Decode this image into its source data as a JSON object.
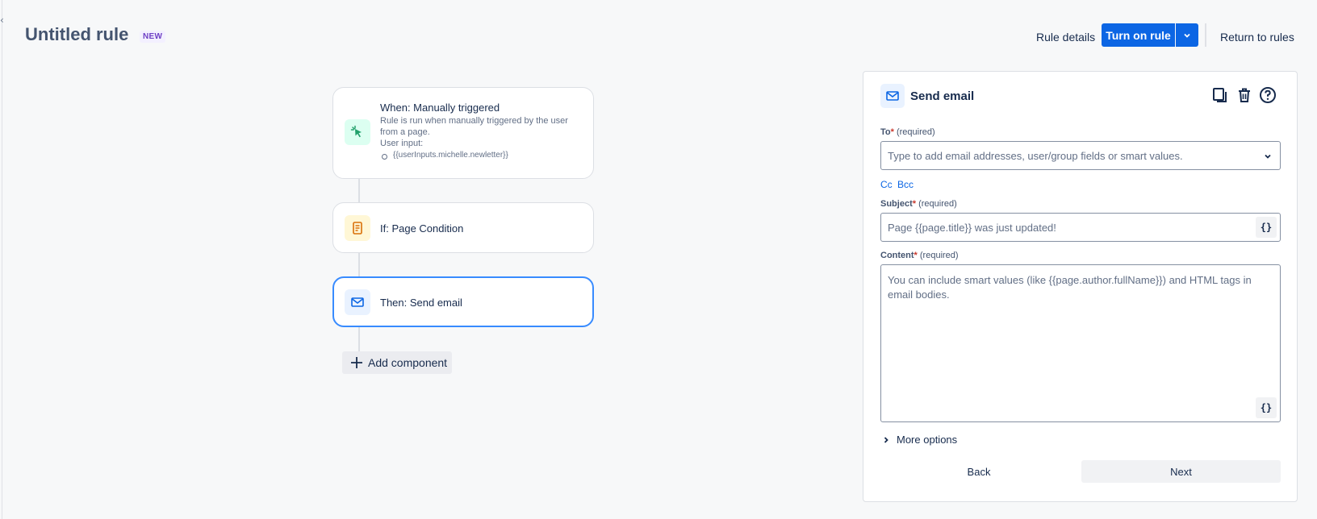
{
  "header": {
    "title": "Untitled rule",
    "badge": "NEW",
    "rule_details": "Rule details",
    "turn_on": "Turn on rule",
    "return": "Return to rules"
  },
  "flow": {
    "trigger": {
      "title": "When: Manually triggered",
      "description": "Rule is run when manually triggered by the user from a page.",
      "user_input_label": "User input:",
      "user_input_item": "{{userInputs.michelle.newletter}}",
      "icon": "cursor-click-icon",
      "color": "#22a06b"
    },
    "condition": {
      "title": "If: Page Condition",
      "icon": "page-icon",
      "color": "#d97008"
    },
    "action": {
      "title": "Then: Send email",
      "icon": "mail-icon",
      "color": "#0c66e4"
    },
    "add_component": "Add component"
  },
  "panel": {
    "title": "Send email",
    "to": {
      "label": "To",
      "required": "*",
      "required_text": " (required)",
      "placeholder": "Type to add email addresses, user/group fields or smart values."
    },
    "cc": "Cc",
    "bcc": "Bcc",
    "subject": {
      "label": "Subject",
      "required": "*",
      "required_text": " (required)",
      "placeholder": "Page {{page.title}} was just updated!"
    },
    "content": {
      "label": "Content",
      "required": "*",
      "required_text": " (required)",
      "placeholder": "You can include smart values (like {{page.author.fullName}}) and HTML tags in email bodies."
    },
    "smart_value_glyph": "{}",
    "more_options": "More options",
    "back": "Back",
    "next": "Next"
  }
}
